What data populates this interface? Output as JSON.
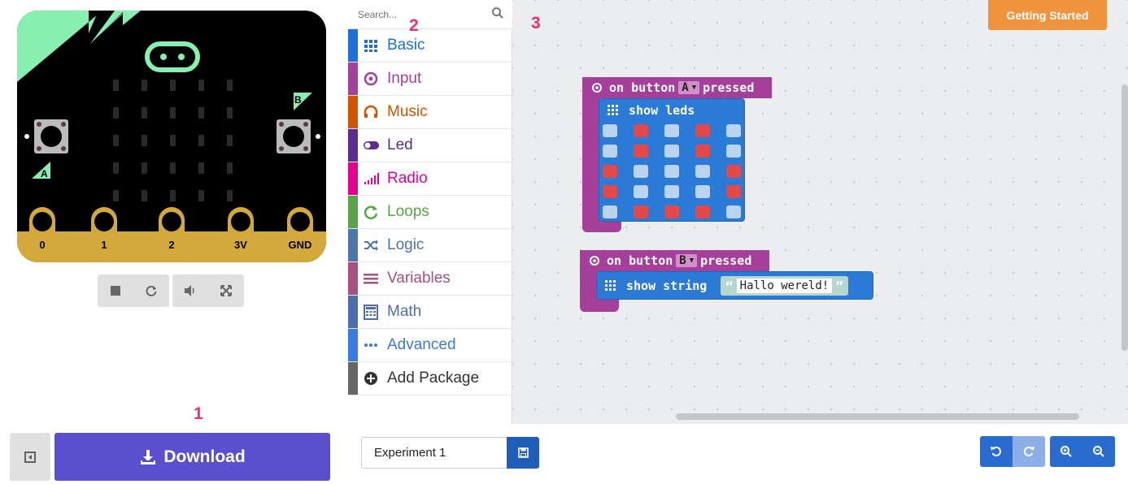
{
  "simulator": {
    "pins": [
      "0",
      "1",
      "2",
      "3V",
      "GND"
    ],
    "button_a_label": "A",
    "button_b_label": "B",
    "controls": [
      {
        "name": "stop-icon",
        "glyph": "■"
      },
      {
        "name": "restart-icon",
        "glyph": "⟳"
      },
      {
        "name": "sound-icon",
        "glyph": "🔉"
      },
      {
        "name": "fullscreen-icon",
        "glyph": "⤢"
      }
    ],
    "colors": {
      "board": "#000000",
      "accent": "#87efb0",
      "pin_gold": "#d4a93b"
    }
  },
  "toolbox": {
    "search_placeholder": "Search...",
    "categories": [
      {
        "label": "Basic",
        "color": "#1e6fd9",
        "text_color": "#1e6fd9",
        "icon": "grid-icon"
      },
      {
        "label": "Input",
        "color": "#a4409a",
        "text_color": "#a4409a",
        "icon": "target-icon"
      },
      {
        "label": "Music",
        "color": "#d35400",
        "text_color": "#d35400",
        "icon": "headphones-icon"
      },
      {
        "label": "Led",
        "color": "#5c2d91",
        "text_color": "#5c2d91",
        "icon": "toggle-icon"
      },
      {
        "label": "Radio",
        "color": "#e3008c",
        "text_color": "#e3008c",
        "icon": "signal-icon"
      },
      {
        "label": "Loops",
        "color": "#58a54a",
        "text_color": "#58a54a",
        "icon": "loop-icon"
      },
      {
        "label": "Logic",
        "color": "#4f75a8",
        "text_color": "#4f75a8",
        "icon": "shuffle-icon"
      },
      {
        "label": "Variables",
        "color": "#a7517f",
        "text_color": "#a7517f",
        "icon": "list-icon"
      },
      {
        "label": "Math",
        "color": "#4d6db0",
        "text_color": "#4d6db0",
        "icon": "calculator-icon"
      },
      {
        "label": "Advanced",
        "color": "#3b7ae0",
        "text_color": "#3b7ae0",
        "icon": "dots-icon"
      },
      {
        "label": "Add Package",
        "color": "#666666",
        "text_color": "#333333",
        "icon": "plus-circle-icon"
      }
    ]
  },
  "workspace": {
    "getting_started_label": "Getting Started",
    "markers": [
      "1",
      "2",
      "3"
    ],
    "block_a": {
      "event_label_pre": "on button",
      "button": "A",
      "event_label_post": "pressed",
      "inner_label": "show leds",
      "leds": [
        [
          0,
          1,
          0,
          1,
          0
        ],
        [
          0,
          1,
          0,
          1,
          0
        ],
        [
          1,
          0,
          0,
          0,
          1
        ],
        [
          1,
          0,
          0,
          0,
          1
        ],
        [
          0,
          1,
          1,
          1,
          0
        ]
      ]
    },
    "block_b": {
      "event_label_pre": "on button",
      "button": "B",
      "event_label_post": "pressed",
      "inner_label": "show string",
      "string_value": "Hallo wereld!"
    }
  },
  "bottom_bar": {
    "download_label": "Download",
    "project_name": "Experiment 1"
  }
}
